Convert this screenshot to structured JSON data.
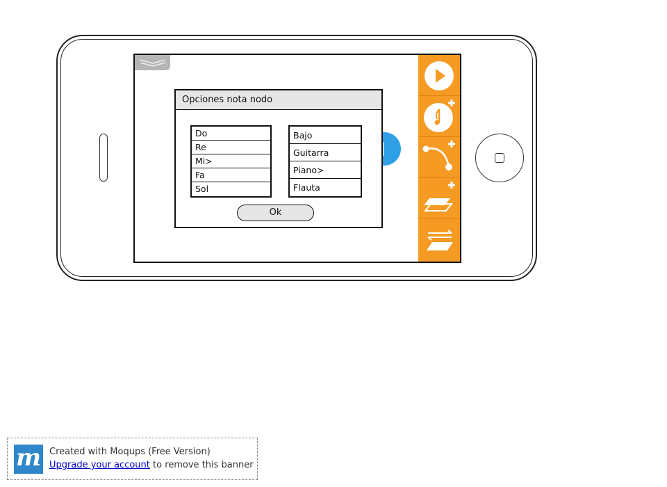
{
  "dialog": {
    "title": "Opciones nota nodo",
    "notes": [
      "Do",
      "Re",
      "Mi>",
      "Fa",
      "Sol"
    ],
    "instruments": [
      "Bajo",
      "Guitarra",
      "Piano>",
      "Flauta"
    ],
    "ok_label": "Ok"
  },
  "toolbar": {
    "tools": [
      "play-icon",
      "add-note-icon",
      "add-connection-icon",
      "add-layer-icon",
      "swap-layer-icon"
    ],
    "accent_color": "#f59a23"
  },
  "node": {
    "color": "#2f9fe6",
    "icon": "note-icon"
  },
  "banner": {
    "logo": "m",
    "line1": "Created with Moqups (Free Version)",
    "link_text": "Upgrade your account",
    "line2_suffix": " to remove this banner"
  }
}
